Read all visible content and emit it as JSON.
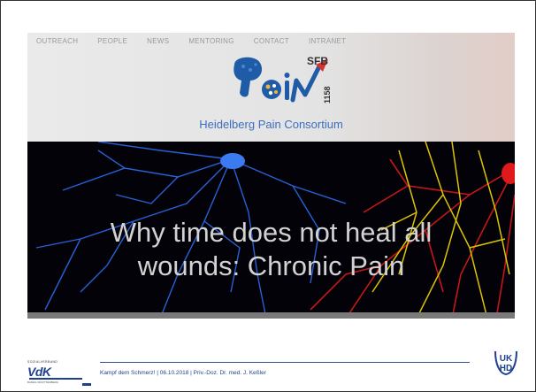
{
  "nav": {
    "items": [
      "OUTREACH",
      "PEOPLE",
      "NEWS",
      "MENTORING",
      "CONTACT",
      "INTRANET"
    ]
  },
  "logo": {
    "wordmark": "Pain",
    "badge": "SFB",
    "number": "1158"
  },
  "site": {
    "title": "Heidelberg Pain Consortium"
  },
  "hero": {
    "headline_line1": "Why time does not heal all",
    "headline_line2": "wounds: Chronic Pain"
  },
  "footer": {
    "org_small": "SOZIALVERBAND",
    "org_big": "VdK",
    "org_sub": "BADEN-WÜRTTEMBERG",
    "text": "Kampf dem Schmerz! | 06.10.2018 | Priv.-Doz. Dr. med. J. Keßler",
    "right_logo_top": "UK",
    "right_logo_bottom": "HD"
  },
  "colors": {
    "accent_blue": "#3b6fc1",
    "dark_blue": "#1f3f8f",
    "logo_red": "#d8322f"
  }
}
